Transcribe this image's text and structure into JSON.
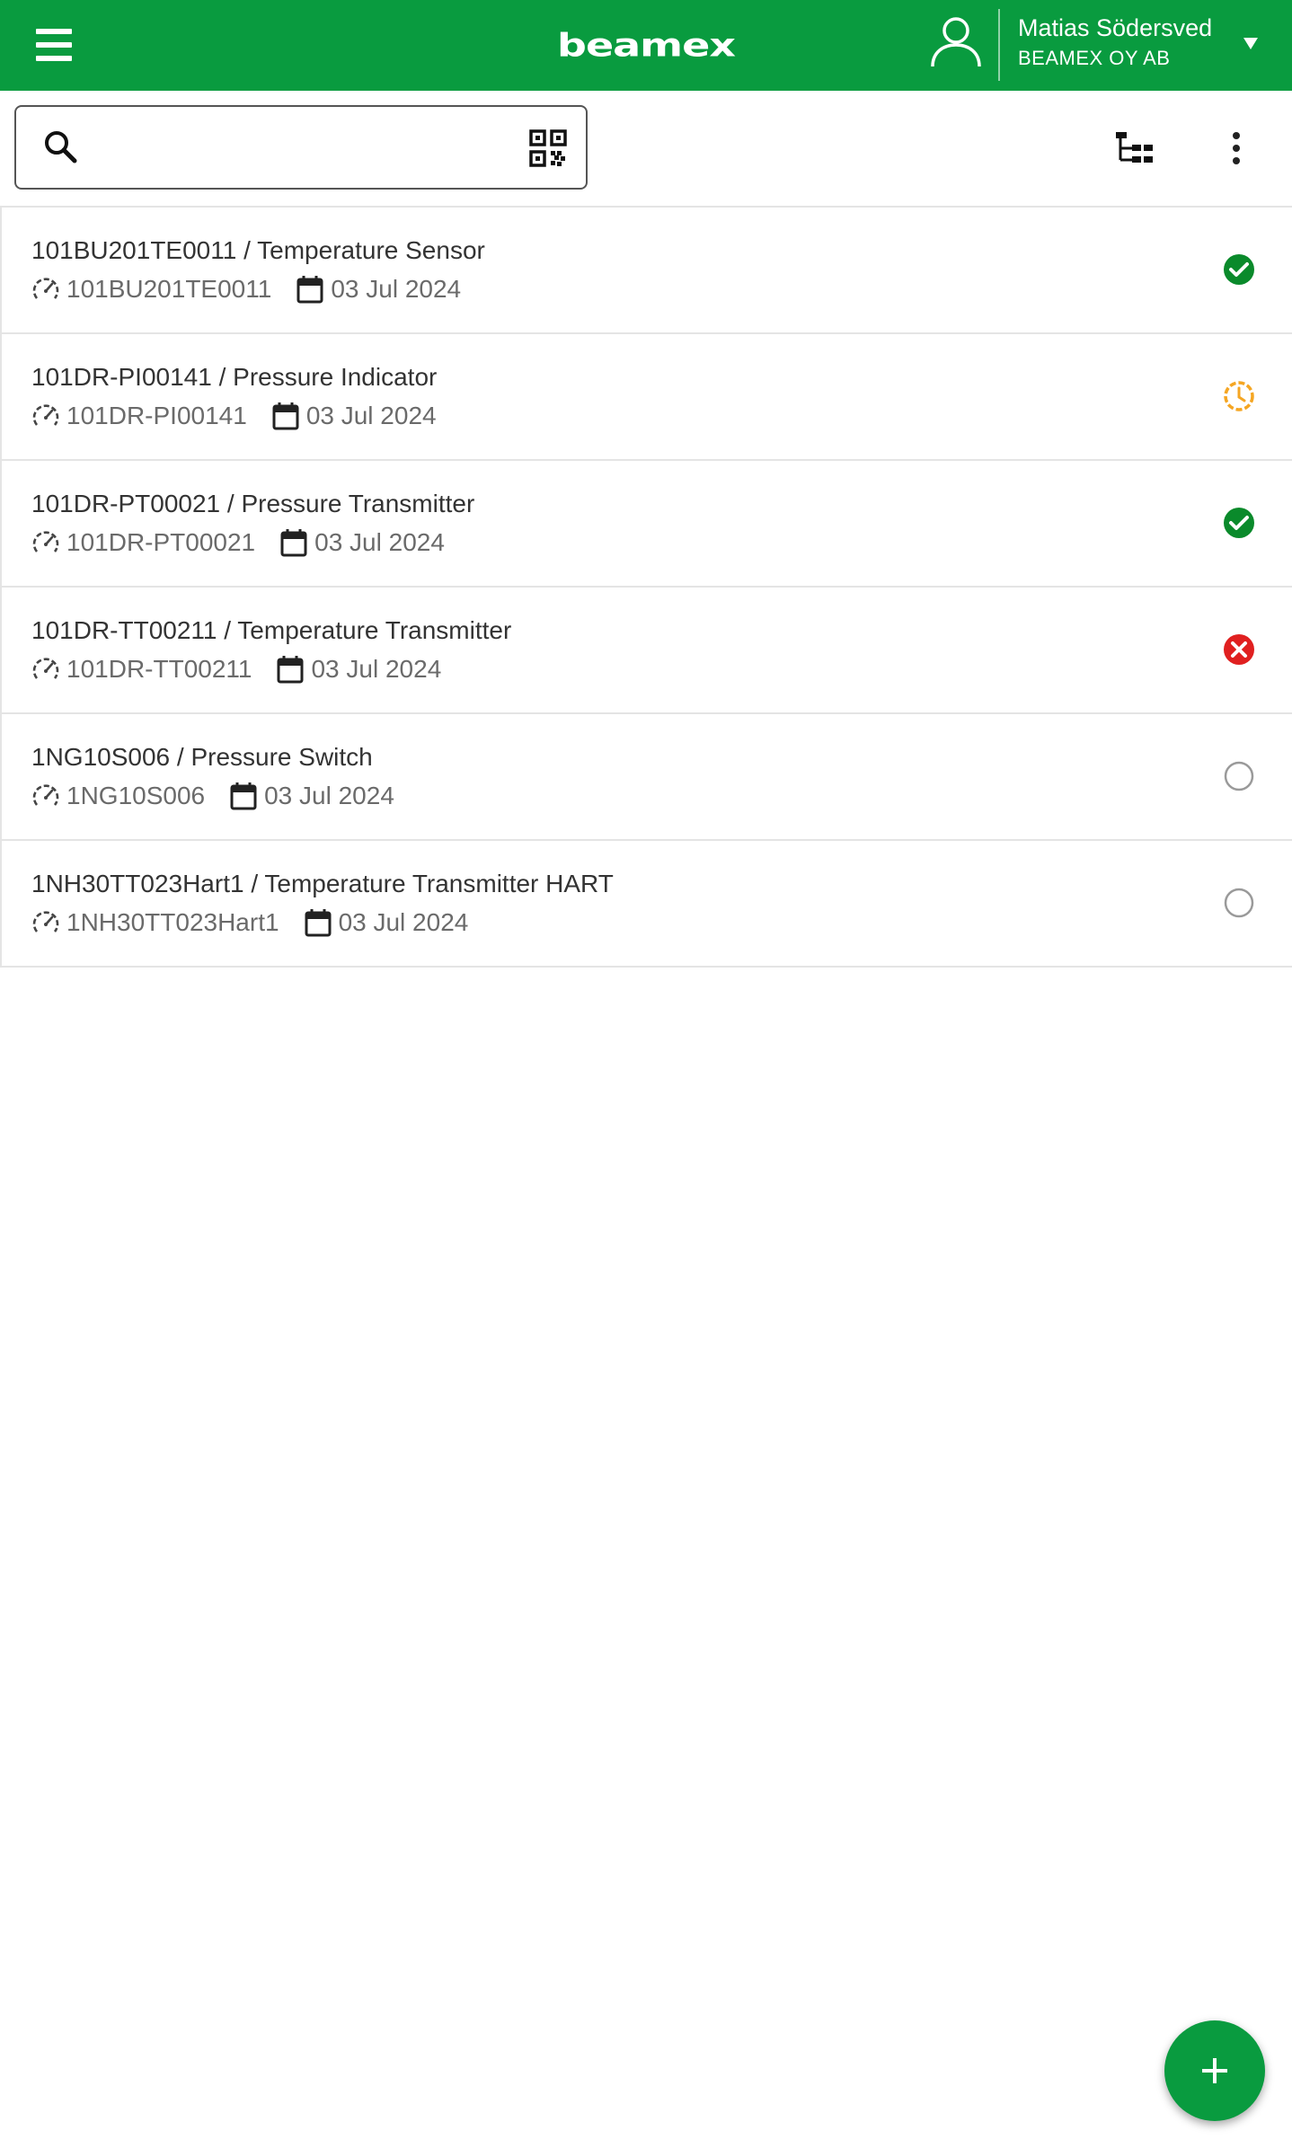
{
  "header": {
    "logo_text": "beamex",
    "user_name": "Matias Södersved",
    "company": "BEAMEX OY AB",
    "brand_color": "#099b3f"
  },
  "search": {
    "placeholder": "",
    "value": ""
  },
  "icons": {
    "menu": "hamburger-menu-icon",
    "user": "user-icon",
    "search": "search-icon",
    "qr": "qr-code-icon",
    "tree": "tree-view-icon",
    "more": "more-vertical-icon",
    "instrument": "gauge-icon",
    "date": "calendar-icon",
    "fab": "plus-icon"
  },
  "status_colors": {
    "passed": "#0a8a2b",
    "in_progress": "#f5a623",
    "failed": "#e02020",
    "not_started": "#9a9a9a"
  },
  "rows": [
    {
      "title": "101BU201TE0011 / Temperature Sensor",
      "position": "101BU201TE0011",
      "date": "03 Jul 2024",
      "status": "passed"
    },
    {
      "title": "101DR-PI00141 / Pressure Indicator",
      "position": "101DR-PI00141",
      "date": "03 Jul 2024",
      "status": "in_progress"
    },
    {
      "title": "101DR-PT00021 / Pressure Transmitter",
      "position": "101DR-PT00021",
      "date": "03 Jul 2024",
      "status": "passed"
    },
    {
      "title": "101DR-TT00211 / Temperature Transmitter",
      "position": "101DR-TT00211",
      "date": "03 Jul 2024",
      "status": "failed"
    },
    {
      "title": "1NG10S006 / Pressure Switch",
      "position": "1NG10S006",
      "date": "03 Jul 2024",
      "status": "not_started"
    },
    {
      "title": "1NH30TT023Hart1 / Temperature Transmitter HART",
      "position": "1NH30TT023Hart1",
      "date": "03 Jul 2024",
      "status": "not_started"
    }
  ]
}
